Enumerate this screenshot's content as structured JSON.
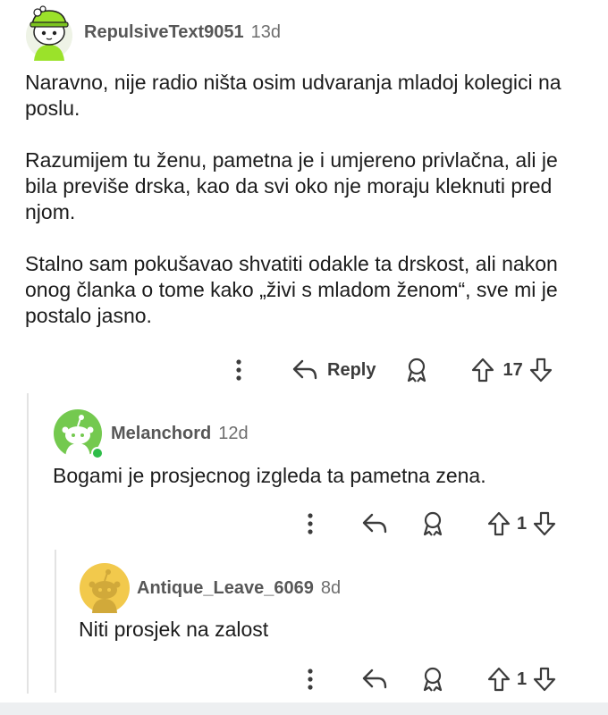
{
  "comments": [
    {
      "username": "RepulsiveText9051",
      "age": "13d",
      "paragraphs": [
        "Naravno, nije radio ništa osim udvaranja mladoj kolegici na poslu.",
        "Razumijem tu ženu, pametna je i umjereno privlačna, ali je bila previše drska, kao da svi oko nje moraju kleknuti pred njom.",
        "Stalno sam pokušavao shvatiti odakle ta drskost, ali nakon onog članka o tome kako „živi s mladom ženom“, sve mi je postalo jasno."
      ],
      "reply_label": "Reply",
      "score": "17",
      "avatar_color": "#8fd33f"
    },
    {
      "username": "Melanchord",
      "age": "12d",
      "paragraphs": [
        "Bogami je prosjecnog izgleda ta pametna zena."
      ],
      "score": "1",
      "avatar_color": "#74c94f",
      "online": true
    },
    {
      "username": "Antique_Leave_6069",
      "age": "8d",
      "paragraphs": [
        "Niti prosjek na zalost"
      ],
      "score": "1",
      "avatar_color": "#f2c94c"
    }
  ],
  "icons": {
    "more": "more-options-icon",
    "reply": "reply-icon",
    "award": "award-icon",
    "upvote": "upvote-icon",
    "downvote": "downvote-icon"
  },
  "colors": {
    "text": "#1c1c1c",
    "meta": "#575757",
    "online": "#2ebd49",
    "thread_line": "#e3e3e3"
  }
}
